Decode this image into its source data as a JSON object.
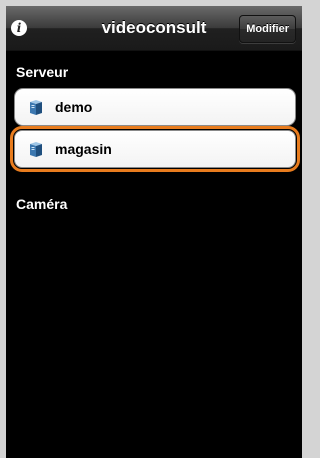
{
  "navbar": {
    "title": "videoconsult",
    "info_icon": "info-icon",
    "right_button_label": "Modifier"
  },
  "sections": {
    "servers_header": "Serveur",
    "cameras_header": "Caméra"
  },
  "servers": [
    {
      "label": "demo",
      "icon": "server-icon",
      "selected": false
    },
    {
      "label": "magasin",
      "icon": "server-icon",
      "selected": true
    }
  ],
  "colors": {
    "highlight": "#e87c1e",
    "background": "#000000",
    "frame": "#d4d4d4"
  }
}
